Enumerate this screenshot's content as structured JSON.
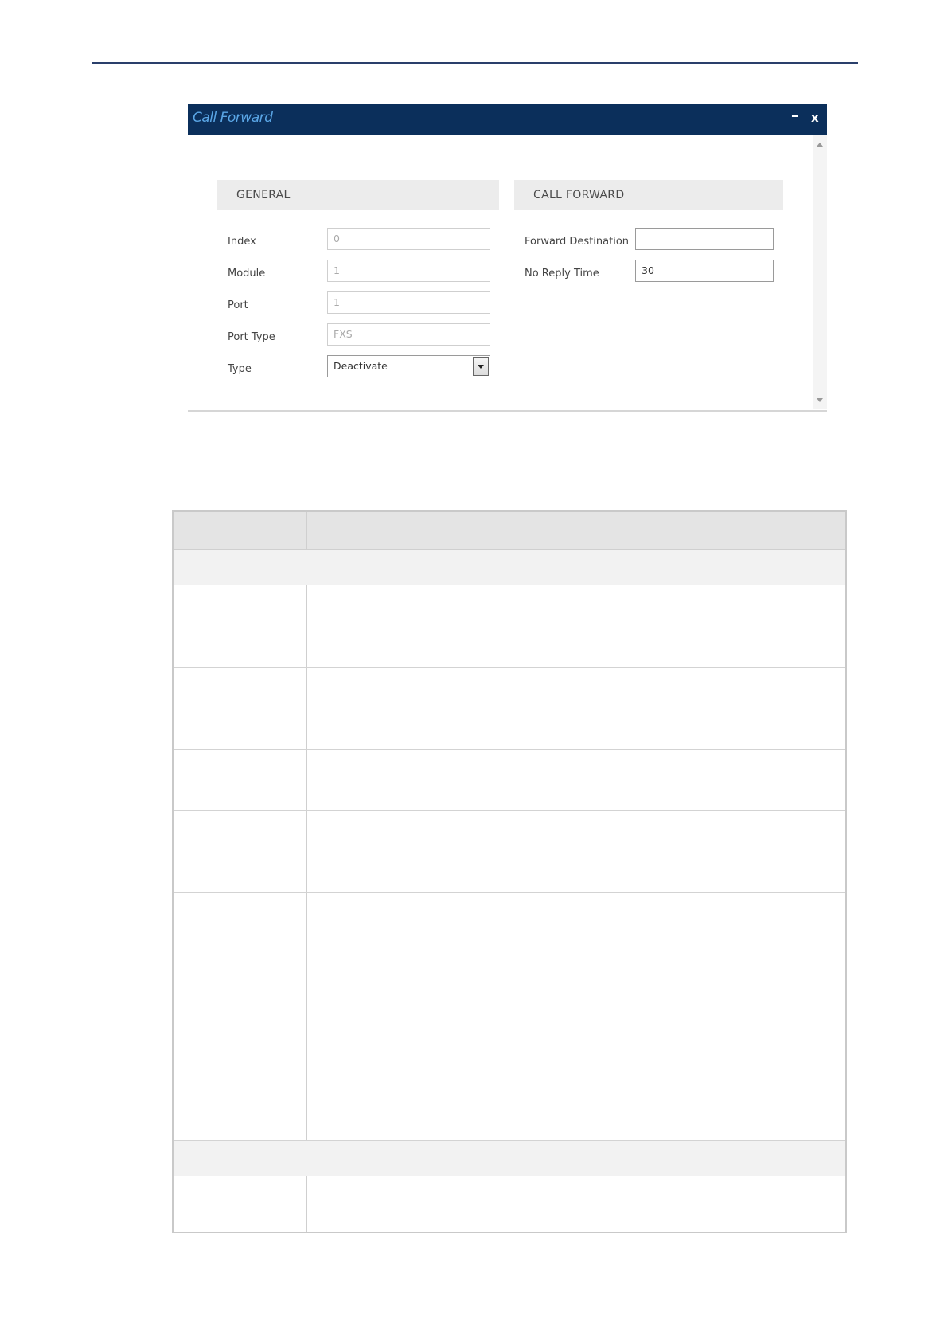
{
  "dialog": {
    "title": "Call Forward",
    "minimize_label": "–",
    "close_label": "x",
    "sections": {
      "general": "GENERAL",
      "call_forward": "CALL FORWARD"
    },
    "general_fields": [
      {
        "label": "Index",
        "value": "0"
      },
      {
        "label": "Module",
        "value": "1"
      },
      {
        "label": "Port",
        "value": "1"
      },
      {
        "label": "Port Type",
        "value": "FXS"
      },
      {
        "label": "Type",
        "value": "Deactivate"
      }
    ],
    "call_forward_fields": [
      {
        "label": "Forward Destination",
        "value": ""
      },
      {
        "label": "No Reply Time",
        "value": "30"
      }
    ]
  }
}
